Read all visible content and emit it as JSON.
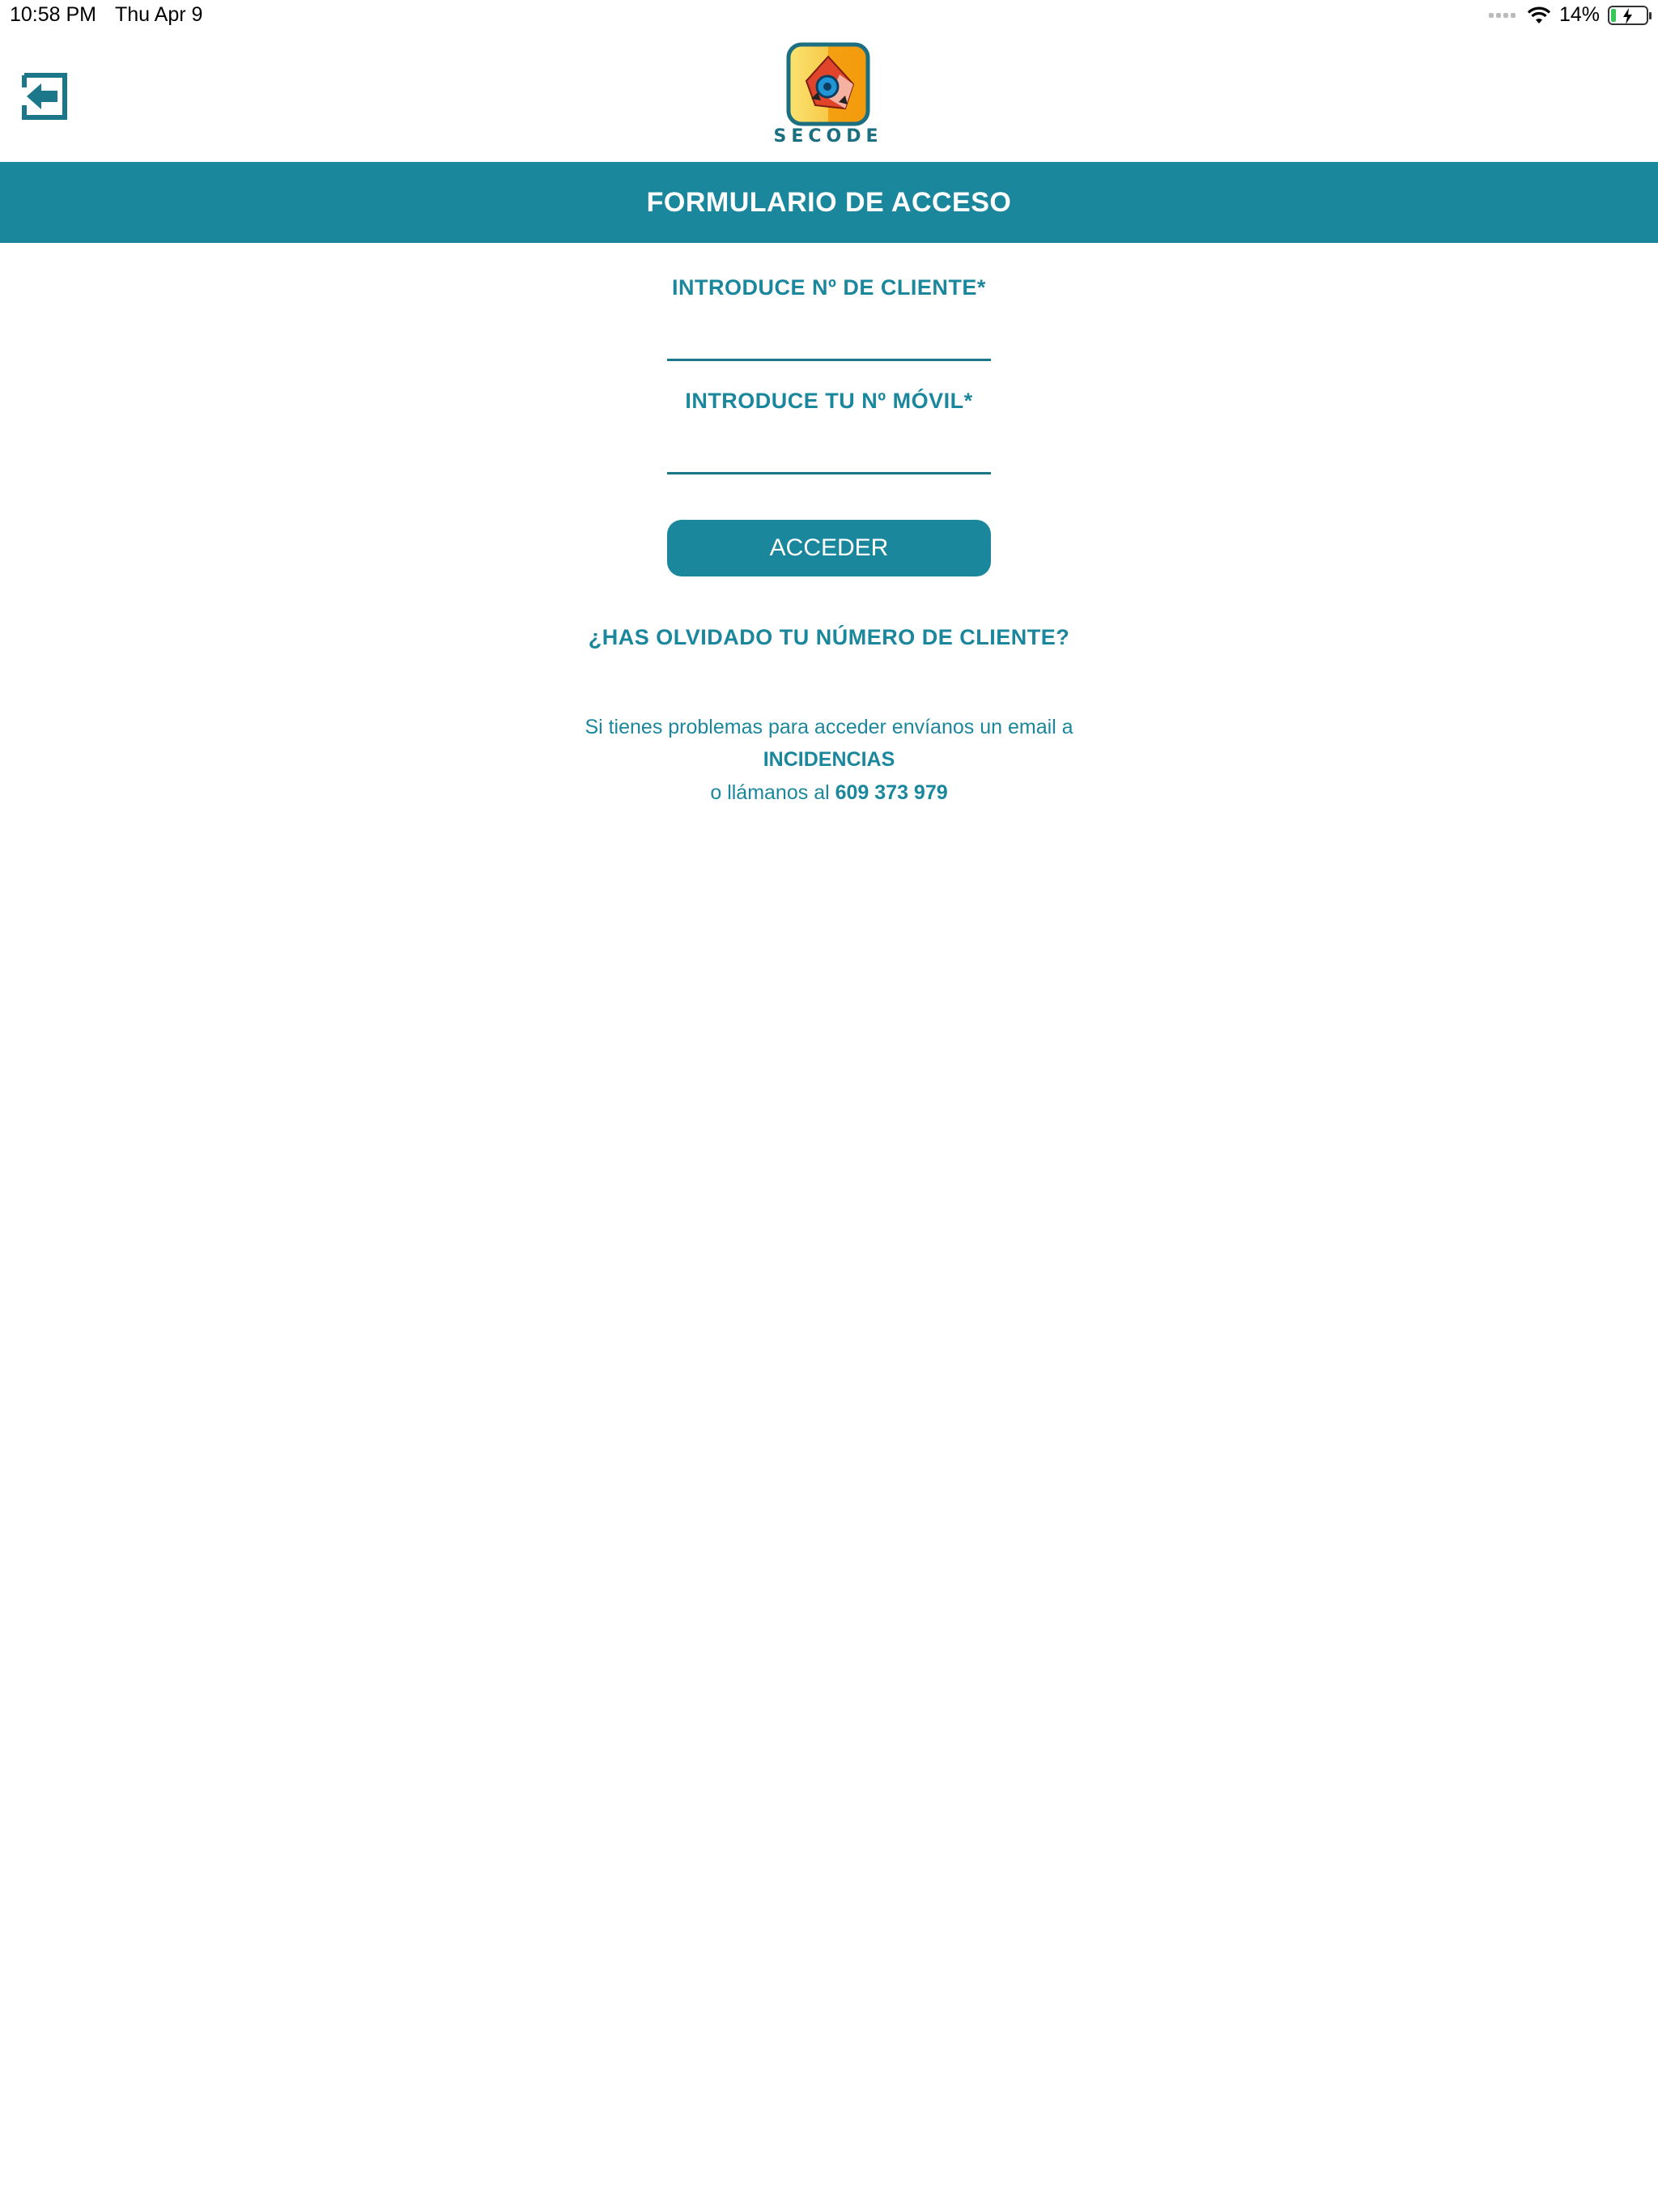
{
  "status_bar": {
    "time": "10:58 PM",
    "date": "Thu Apr 9",
    "battery_percent": "14%",
    "battery_level": 0.14,
    "icons": [
      "cellular-icon",
      "wifi-icon",
      "battery-charging-icon"
    ]
  },
  "header": {
    "back_icon": "exit-arrow-icon",
    "logo_text": "SECODE"
  },
  "banner": {
    "title": "FORMULARIO DE ACCESO"
  },
  "form": {
    "client_label": "INTRODUCE Nº DE CLIENTE*",
    "client_value": "",
    "mobile_label": "INTRODUCE TU Nº MÓVIL*",
    "mobile_value": "",
    "submit_label": "ACCEDER"
  },
  "forgot_link": "¿HAS OLVIDADO TU NÚMERO DE CLIENTE?",
  "help": {
    "line1": "Si tienes problemas para acceder envíanos un email a",
    "email_link": "INCIDENCIAS",
    "line3_prefix": "o llámanos al",
    "phone": "609 373 979"
  },
  "colors": {
    "accent": "#1b879c",
    "dark_accent": "#1b7789",
    "background": "#ffffff"
  }
}
